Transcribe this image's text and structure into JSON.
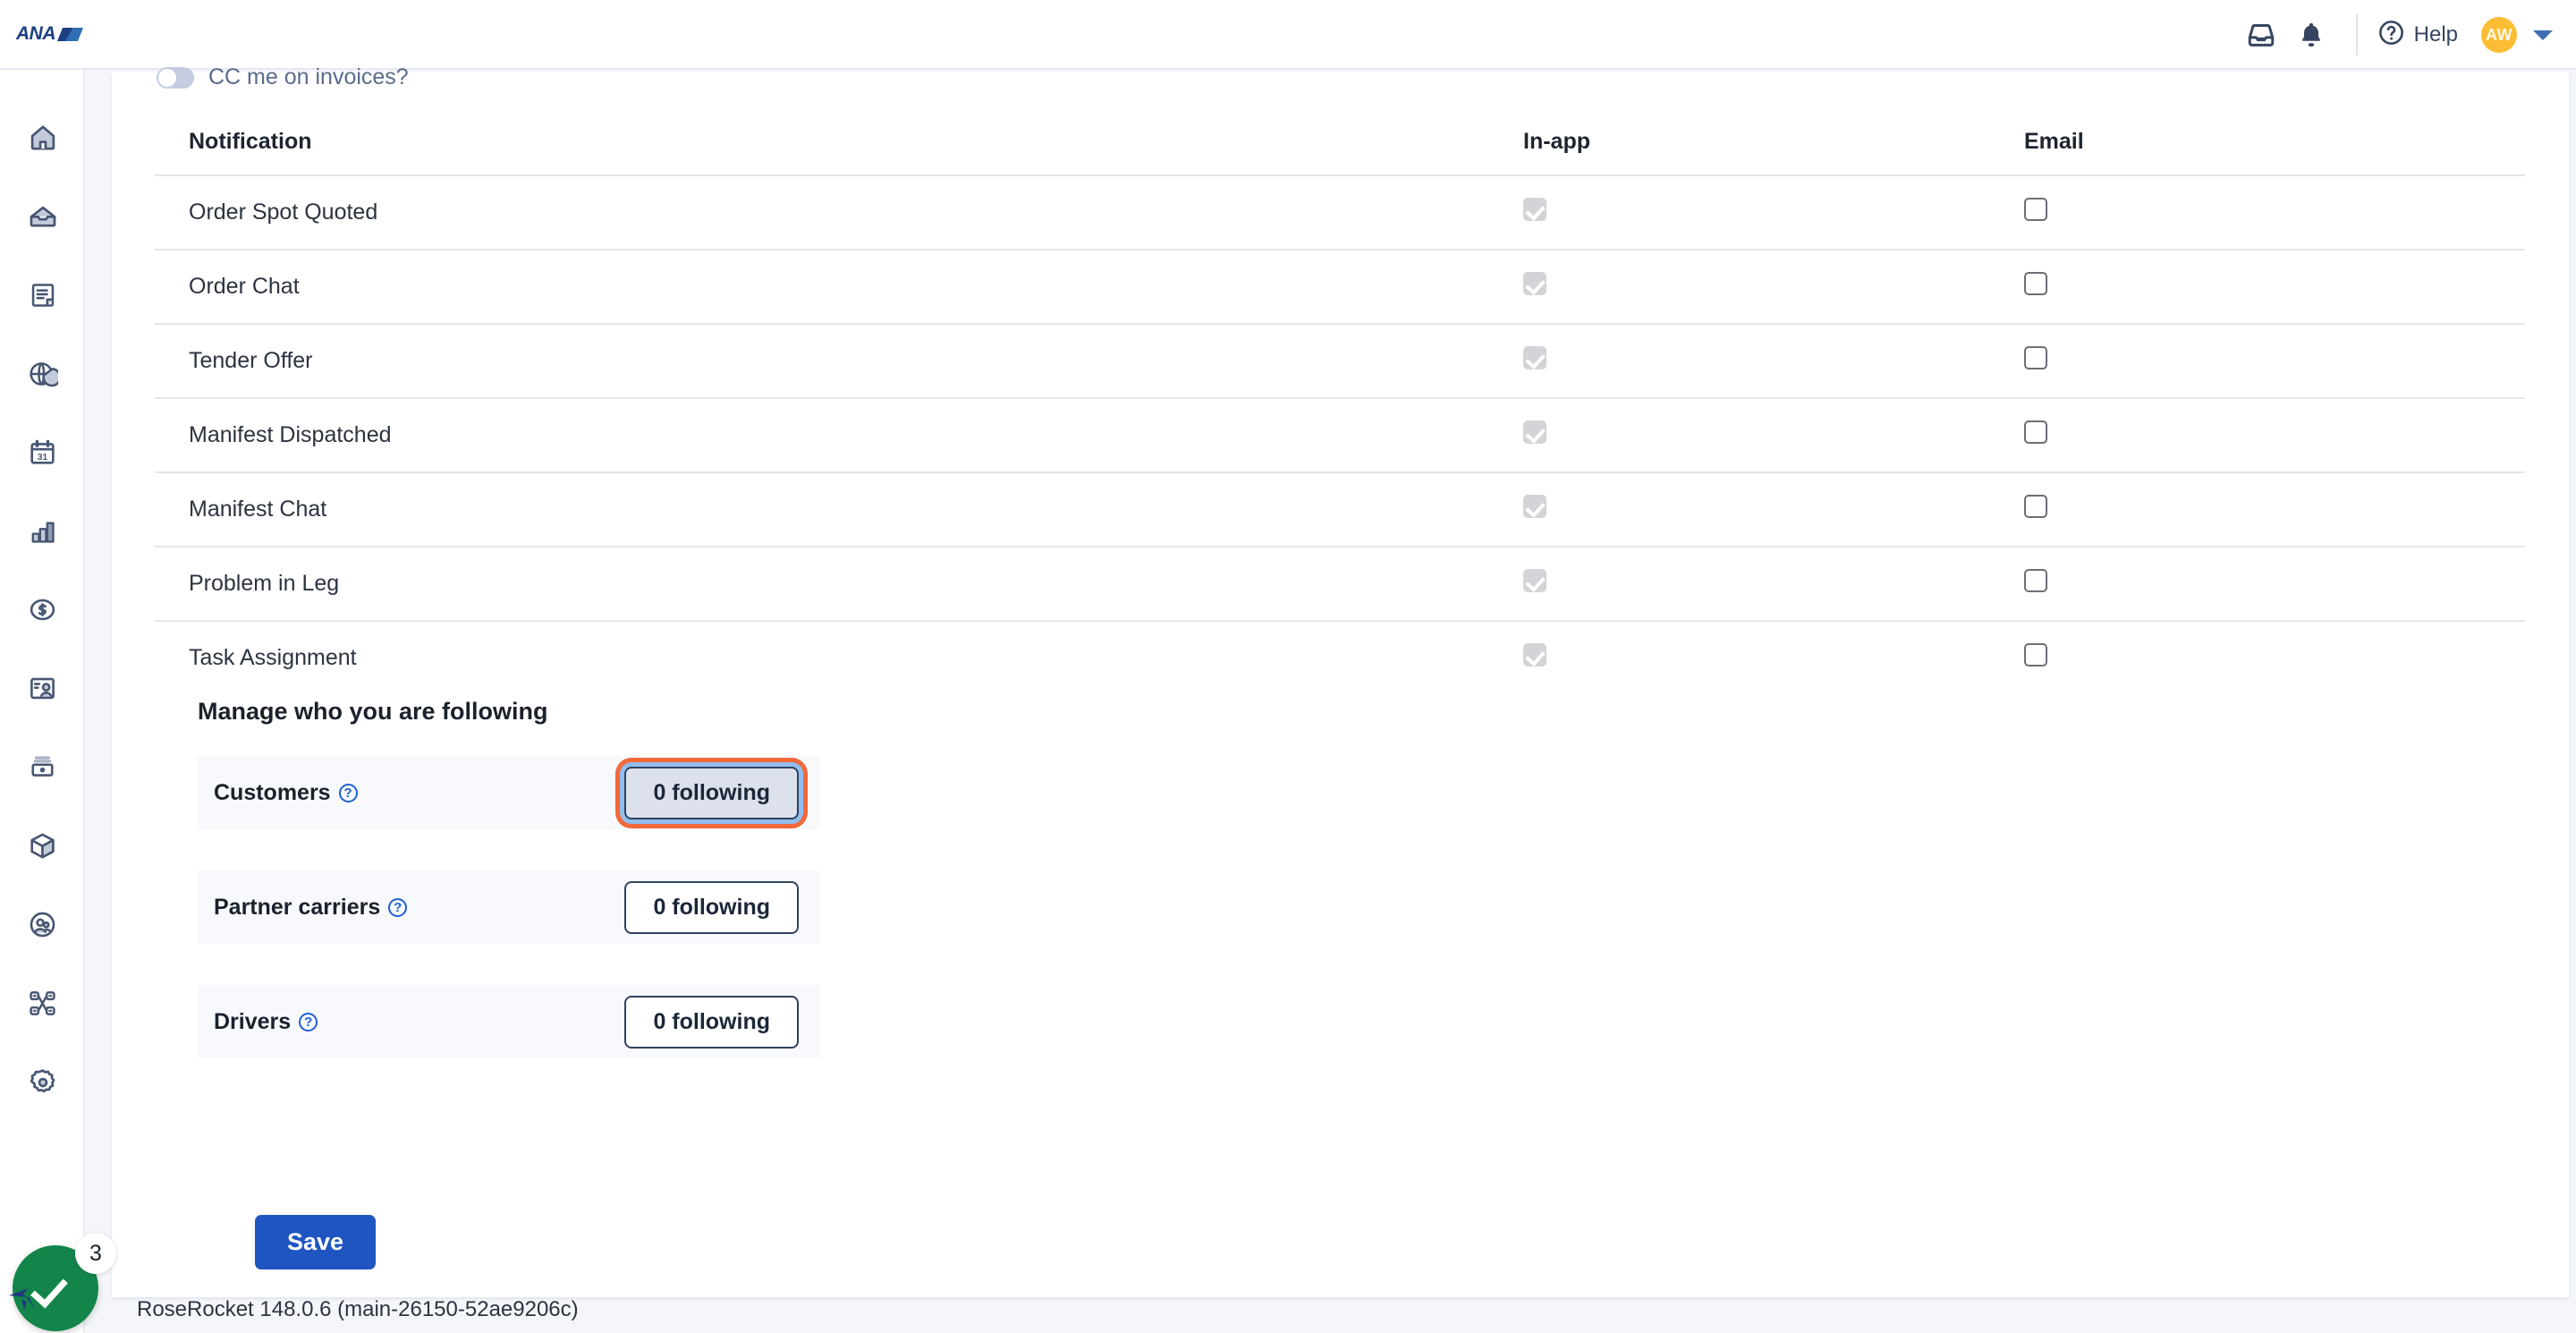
{
  "header": {
    "brand": "ANA",
    "icons": [
      {
        "name": "inbox-tray-icon"
      },
      {
        "name": "bell-icon"
      }
    ],
    "help_label": "Help",
    "avatar_initials": "AW",
    "caret_icon": "chevron-down-icon"
  },
  "sidebar": {
    "items": [
      {
        "icon": "home-icon",
        "label": "Home"
      },
      {
        "icon": "inbox-envelope-icon",
        "label": "Inbox"
      },
      {
        "icon": "document-icon",
        "label": "Documents"
      },
      {
        "icon": "globe-pie-icon",
        "label": "Orders"
      },
      {
        "icon": "calendar-31-icon",
        "label": "Schedule"
      },
      {
        "icon": "bar-chart-icon",
        "label": "Reports"
      },
      {
        "icon": "dollar-circle-icon",
        "label": "Billing"
      },
      {
        "icon": "id-card-icon",
        "label": "Contacts"
      },
      {
        "icon": "printer-icon",
        "label": "Print"
      },
      {
        "icon": "cube-icon",
        "label": "Assets"
      },
      {
        "icon": "users-circle-icon",
        "label": "Partners"
      },
      {
        "icon": "network-nodes-icon",
        "label": "Integrations"
      },
      {
        "icon": "gear-icon",
        "label": "Settings"
      }
    ]
  },
  "settings": {
    "cc_invoices": {
      "label": "CC me on invoices?",
      "enabled": false
    },
    "notifications_table": {
      "columns": [
        "Notification",
        "In-app",
        "Email"
      ],
      "rows": [
        {
          "name": "Order Spot Quoted",
          "in_app": true,
          "in_app_disabled": true,
          "email": false
        },
        {
          "name": "Order Chat",
          "in_app": true,
          "in_app_disabled": true,
          "email": false
        },
        {
          "name": "Tender Offer",
          "in_app": true,
          "in_app_disabled": true,
          "email": false
        },
        {
          "name": "Manifest Dispatched",
          "in_app": true,
          "in_app_disabled": true,
          "email": false
        },
        {
          "name": "Manifest Chat",
          "in_app": true,
          "in_app_disabled": true,
          "email": false
        },
        {
          "name": "Problem in Leg",
          "in_app": true,
          "in_app_disabled": true,
          "email": false
        },
        {
          "name": "Task Assignment",
          "in_app": true,
          "in_app_disabled": true,
          "email": false
        }
      ]
    },
    "following": {
      "heading": "Manage who you are following",
      "rows": [
        {
          "label": "Customers",
          "button_label": "0 following",
          "focused": true
        },
        {
          "label": "Partner carriers",
          "button_label": "0 following",
          "focused": false
        },
        {
          "label": "Drivers",
          "button_label": "0 following",
          "focused": false
        }
      ],
      "help_glyph": "?"
    },
    "save_label": "Save"
  },
  "footer": {
    "version": "RoseRocket 148.0.6 (main-26150-52ae9206c)"
  },
  "support_widget": {
    "icon": "check-circle-icon",
    "badge_count": "3"
  },
  "colors": {
    "accent_blue": "#1f55c0",
    "focus_orange": "#f2693a",
    "focus_blue": "#93bdee",
    "avatar_amber": "#fbbd33",
    "support_green": "#13854a",
    "navy_text": "#36455f"
  }
}
